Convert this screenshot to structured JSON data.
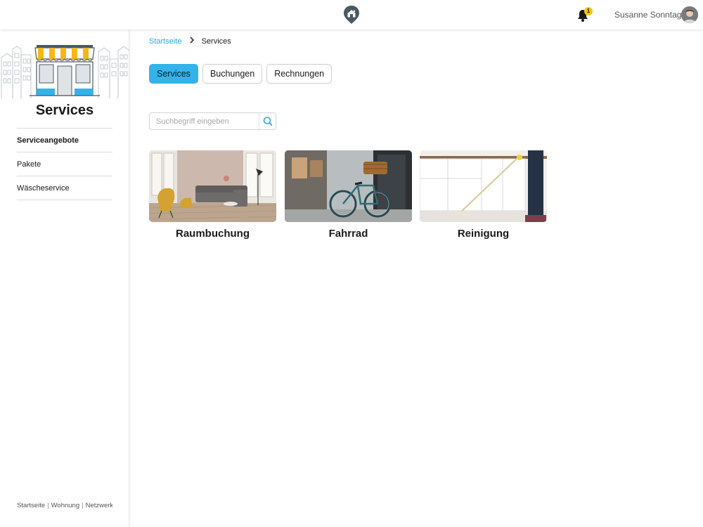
{
  "header": {
    "logo_icon": "home-pin-icon",
    "notification_icon": "bell-icon",
    "notification_count": "1",
    "user_name": "Susanne Sonntag",
    "avatar_icon": "user-avatar"
  },
  "sidebar": {
    "title": "Services",
    "illustration": "storefront-illustration",
    "items": [
      {
        "label": "Serviceangebote",
        "active": true
      },
      {
        "label": "Pakete",
        "active": false
      },
      {
        "label": "Wäscheservice",
        "active": false
      }
    ],
    "footer_links": [
      "Startseite",
      "Wohnung",
      "Netzwerk"
    ]
  },
  "breadcrumb": {
    "home": "Startseite",
    "current": "Services"
  },
  "tabs": [
    {
      "label": "Services",
      "active": true
    },
    {
      "label": "Buchungen",
      "active": false
    },
    {
      "label": "Rechnungen",
      "active": false
    }
  ],
  "search": {
    "placeholder": "Suchbegriff eingeben",
    "value": "",
    "icon": "search-icon"
  },
  "cards": [
    {
      "label": "Raumbuchung",
      "image": "living-room-photo"
    },
    {
      "label": "Fahrrad",
      "image": "bicycle-photo"
    },
    {
      "label": "Reinigung",
      "image": "cleaning-photo"
    }
  ],
  "colors": {
    "accent": "#34b3ea",
    "link": "#2aa8e0",
    "badge": "#f5c518",
    "logo": "#4a5a63"
  }
}
